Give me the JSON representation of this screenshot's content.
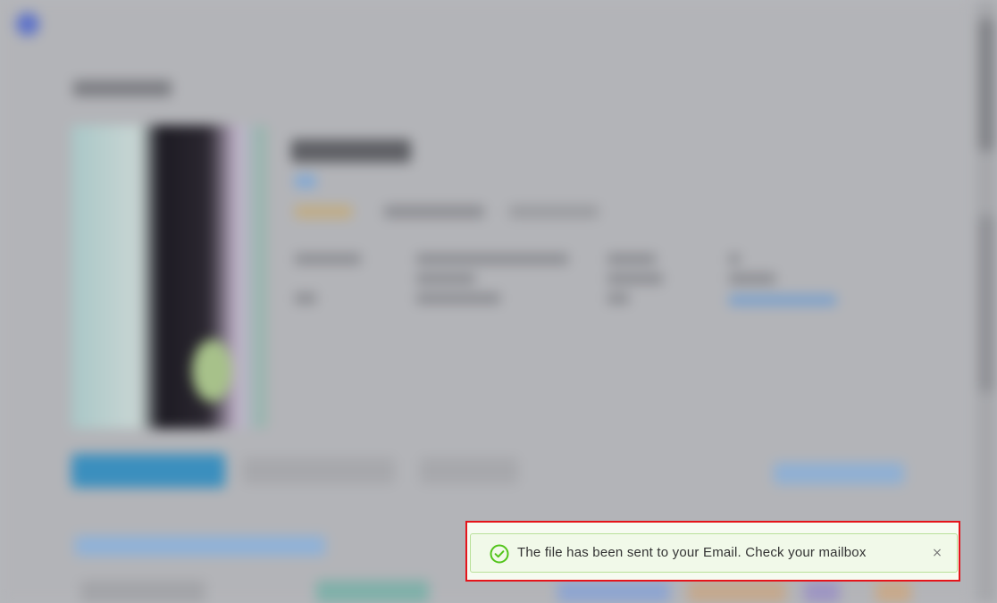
{
  "toast": {
    "message": "The file has been sent to your Email. Check your mailbox",
    "close_glyph": "×",
    "status_icon": "check-circle-icon",
    "close_icon": "close-icon",
    "accent_color": "#52c41a",
    "border_highlight_color": "#e5141b"
  }
}
